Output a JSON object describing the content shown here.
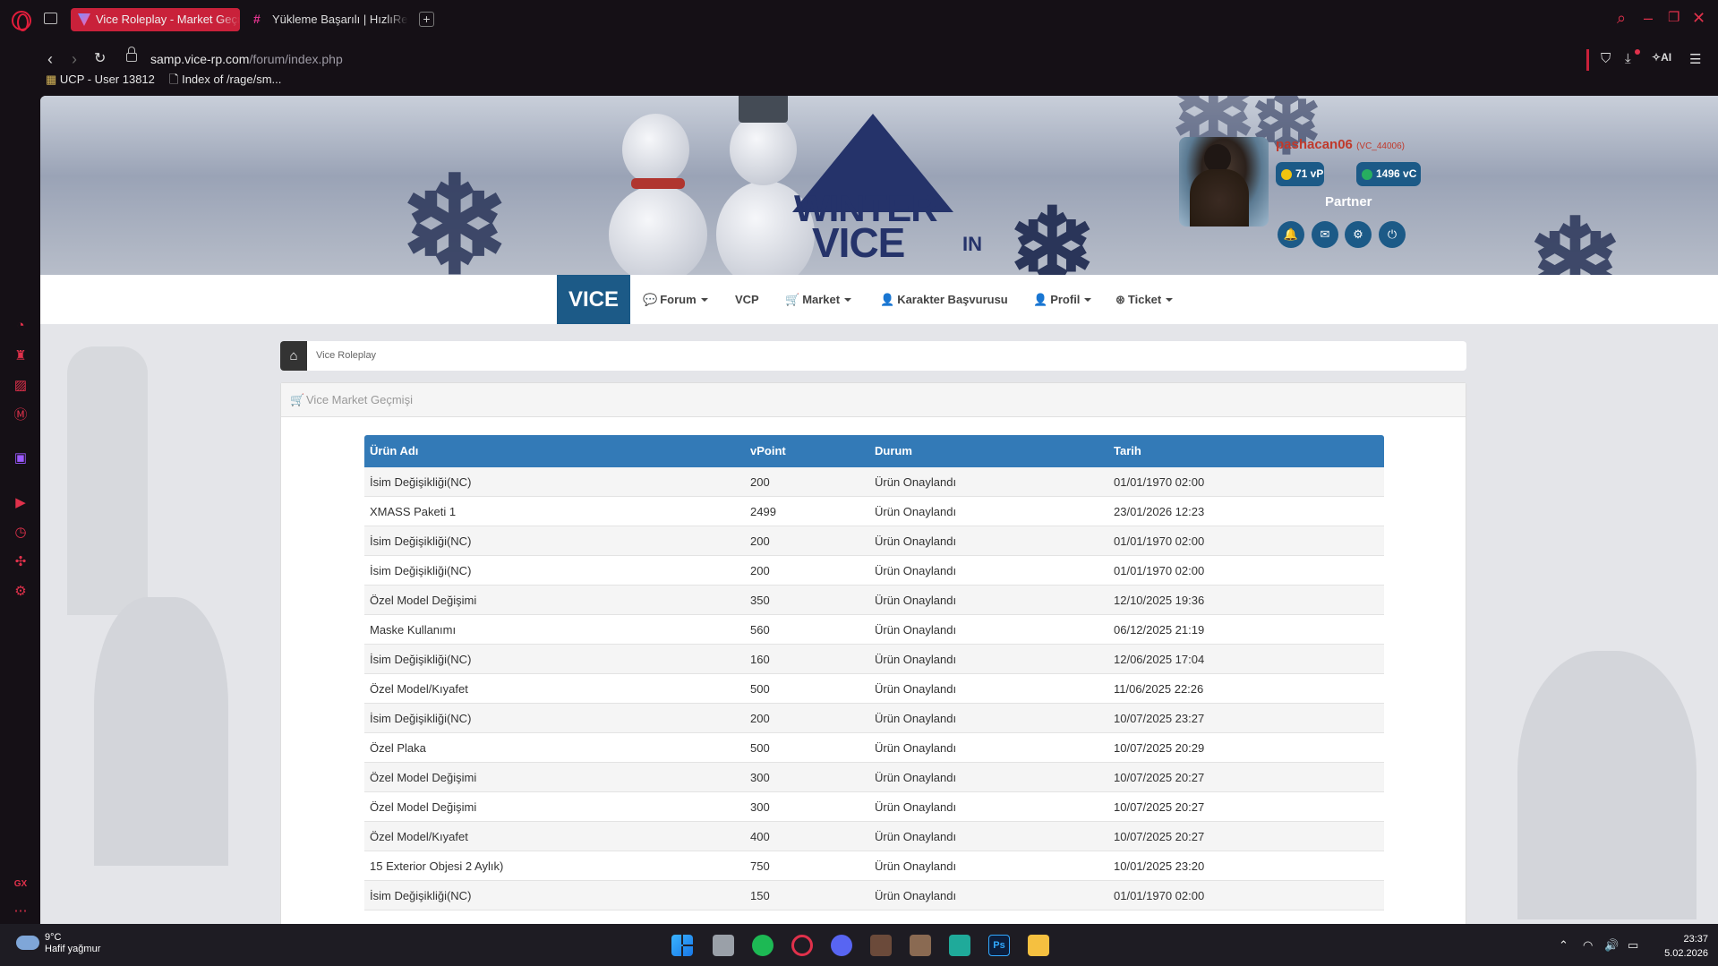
{
  "browser": {
    "tabs": [
      {
        "label": "Vice Roleplay - Market Geçmişi",
        "active": true
      },
      {
        "label": "Yükleme Başarılı | HızlıResim",
        "active": false
      }
    ],
    "url_host": "samp.vice-rp.com",
    "url_path": "/forum/index.php",
    "ai_label": "AI",
    "bookmarks": [
      "UCP - User 13812",
      "Index of /rage/sm..."
    ],
    "sidebar_label": "GX"
  },
  "profile": {
    "username": "pashacan06",
    "user_id": "(VC_44006)",
    "vp": "71 vP",
    "vc": "1496 vC",
    "rank": "Partner"
  },
  "navbar": {
    "brand": "VICE",
    "items": [
      "Forum",
      "VCP",
      "Market",
      "Karakter Başvurusu",
      "Profil",
      "Ticket"
    ]
  },
  "breadcrumb": {
    "home": "Vice Roleplay"
  },
  "panel": {
    "title": "Vice Market Geçmişi"
  },
  "table": {
    "headers": [
      "Ürün Adı",
      "vPoint",
      "Durum",
      "Tarih"
    ],
    "rows": [
      [
        "İsim Değişikliği(NC)",
        "200",
        "Ürün Onaylandı",
        "01/01/1970 02:00"
      ],
      [
        "XMASS Paketi 1",
        "2499",
        "Ürün Onaylandı",
        "23/01/2026 12:23"
      ],
      [
        "İsim Değişikliği(NC)",
        "200",
        "Ürün Onaylandı",
        "01/01/1970 02:00"
      ],
      [
        "İsim Değişikliği(NC)",
        "200",
        "Ürün Onaylandı",
        "01/01/1970 02:00"
      ],
      [
        "Özel Model Değişimi",
        "350",
        "Ürün Onaylandı",
        "12/10/2025 19:36"
      ],
      [
        "Maske Kullanımı",
        "560",
        "Ürün Onaylandı",
        "06/12/2025 21:19"
      ],
      [
        "İsim Değişikliği(NC)",
        "160",
        "Ürün Onaylandı",
        "12/06/2025 17:04"
      ],
      [
        "Özel Model/Kıyafet",
        "500",
        "Ürün Onaylandı",
        "11/06/2025 22:26"
      ],
      [
        "İsim Değişikliği(NC)",
        "200",
        "Ürün Onaylandı",
        "10/07/2025 23:27"
      ],
      [
        "Özel Plaka",
        "500",
        "Ürün Onaylandı",
        "10/07/2025 20:29"
      ],
      [
        "Özel Model Değişimi",
        "300",
        "Ürün Onaylandı",
        "10/07/2025 20:27"
      ],
      [
        "Özel Model Değişimi",
        "300",
        "Ürün Onaylandı",
        "10/07/2025 20:27"
      ],
      [
        "Özel Model/Kıyafet",
        "400",
        "Ürün Onaylandı",
        "10/07/2025 20:27"
      ],
      [
        "15 Exterior Objesi 2 Aylık)",
        "750",
        "Ürün Onaylandı",
        "10/01/2025 23:20"
      ],
      [
        "İsim Değişikliği(NC)",
        "150",
        "Ürün Onaylandı",
        "01/01/1970 02:00"
      ]
    ]
  },
  "taskbar": {
    "temperature": "9°C",
    "weather": "Hafif yağmur",
    "time": "23:37",
    "date": "5.02.2026"
  },
  "colors": {
    "accent_red": "#c9213a",
    "nav_blue": "#1c5a87",
    "table_head": "#337ab7"
  }
}
